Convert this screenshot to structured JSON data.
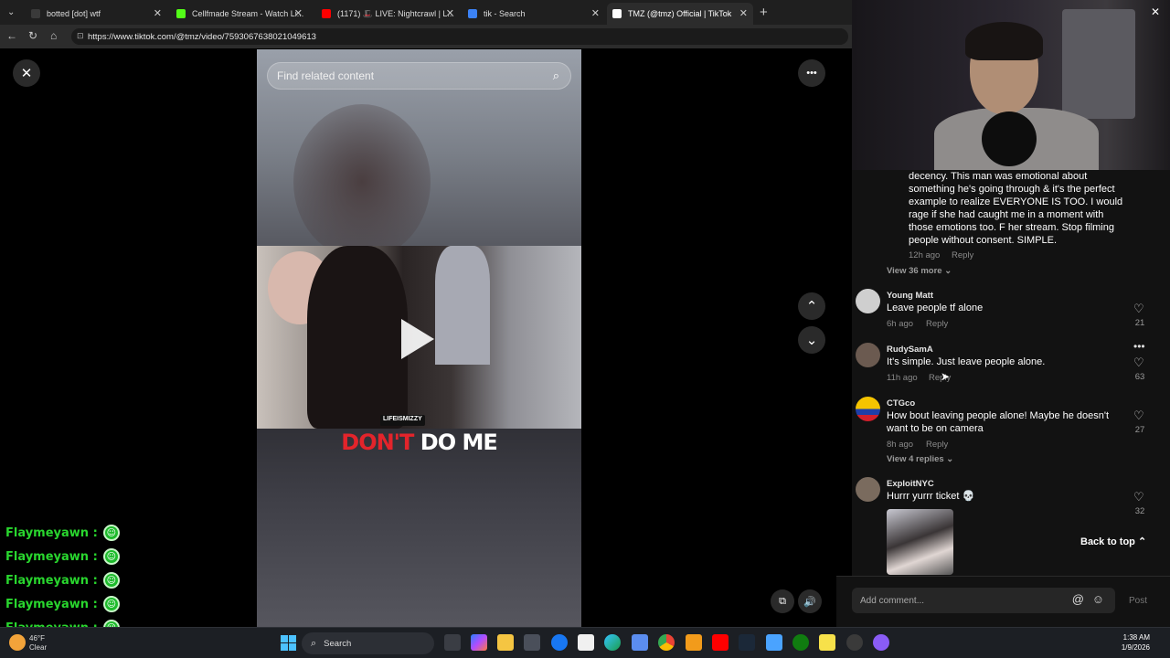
{
  "browser": {
    "tabs": [
      {
        "label": "botted [dot] wtf",
        "color": "#3a3a3a"
      },
      {
        "label": "Cellfmade Stream - Watch Li...",
        "color": "#53fc18"
      },
      {
        "label": "(1171) 🎩 LIVE: Nightcrawl | L...",
        "color": "#ff0000"
      },
      {
        "label": "tik - Search",
        "color": "#3b82f6"
      },
      {
        "label": "TMZ (@tmz) Official | TikTok",
        "color": "#ffffff"
      }
    ],
    "new_tab": "+",
    "url": "https://www.tiktok.com/@tmz/video/7593067638021049613"
  },
  "player": {
    "search_placeholder": "Find related content",
    "caption_red": "DON'T",
    "caption_white": "DO ME",
    "social_handle": "LIFEISMIZZY",
    "close": "✕",
    "more": "•••",
    "up": "⌃",
    "down": "⌄",
    "volume": "🔊"
  },
  "comments": {
    "partial_text": "decency. This man was emotional about something he's going through & it's the perfect example to realize EVERYONE IS TOO. I would rage if she had caught me in a moment with those emotions too. F her stream. Stop filming people without consent. SIMPLE.",
    "partial_time": "12h ago",
    "reply_label": "Reply",
    "view_more": "View 36 more",
    "items": [
      {
        "user": "Young Matt",
        "text": "Leave people tf alone",
        "time": "6h ago",
        "likes": "21",
        "avatar": "#cfcfcf"
      },
      {
        "user": "RudySamA",
        "text": "It's simple. Just leave people alone.",
        "time": "11h ago",
        "likes": "63",
        "avatar": "#6b5a50"
      },
      {
        "user": "CTGco",
        "text": "How bout leaving people alone! Maybe he doesn't want to be on camera",
        "time": "8h ago",
        "likes": "27",
        "avatar": "#f5c400",
        "replies": "View 4 replies"
      },
      {
        "user": "ExploitNYC",
        "text": "Hurrr yurrr ticket 💀",
        "time": "",
        "likes": "32",
        "avatar": "#7a6b5e"
      }
    ],
    "back_to_top": "Back to top",
    "add_comment": "Add comment...",
    "post": "Post"
  },
  "chat": {
    "lines": [
      "Flaymeyawn :",
      "Flaymeyawn :",
      "Flaymeyawn :",
      "Flaymeyawn :",
      "Flaymeyawn :"
    ]
  },
  "taskbar": {
    "search": "Search",
    "temp": "46°F",
    "weather": "Clear",
    "time": "1:38 AM",
    "date": "1/9/2026"
  }
}
